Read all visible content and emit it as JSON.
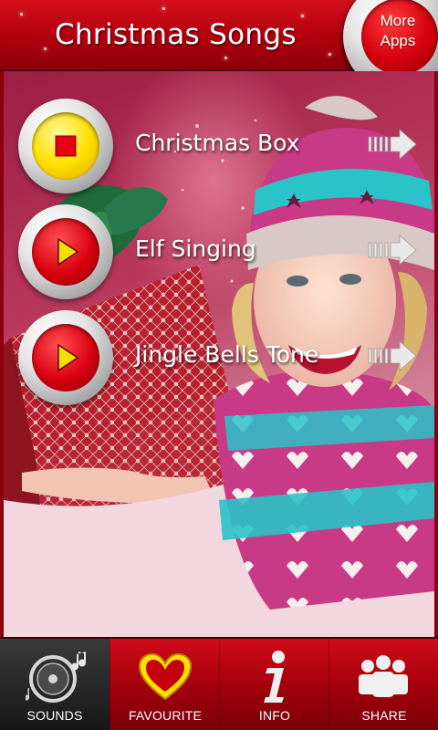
{
  "header": {
    "title": "Christmas Songs",
    "more_apps_label": "More Apps"
  },
  "sounds": [
    {
      "label": "Christmas Box",
      "state": "playing",
      "icon": "stop-icon"
    },
    {
      "label": "Elf Singing",
      "state": "idle",
      "icon": "play-icon"
    },
    {
      "label": "Jingle Bells Tone",
      "state": "idle",
      "icon": "play-icon"
    }
  ],
  "tabs": [
    {
      "label": "SOUNDS",
      "icon": "music-disc-icon",
      "selected": true
    },
    {
      "label": "FAVOURITE",
      "icon": "heart-icon",
      "selected": false
    },
    {
      "label": "INFO",
      "icon": "info-icon",
      "selected": false
    },
    {
      "label": "SHARE",
      "icon": "people-icon",
      "selected": false
    }
  ],
  "colors": {
    "header_red": "#b1000d",
    "active_button": "#ffe100",
    "play_triangle": "#f2e000",
    "selected_tab": "#1f1f1f",
    "heart": "#ffe000"
  }
}
